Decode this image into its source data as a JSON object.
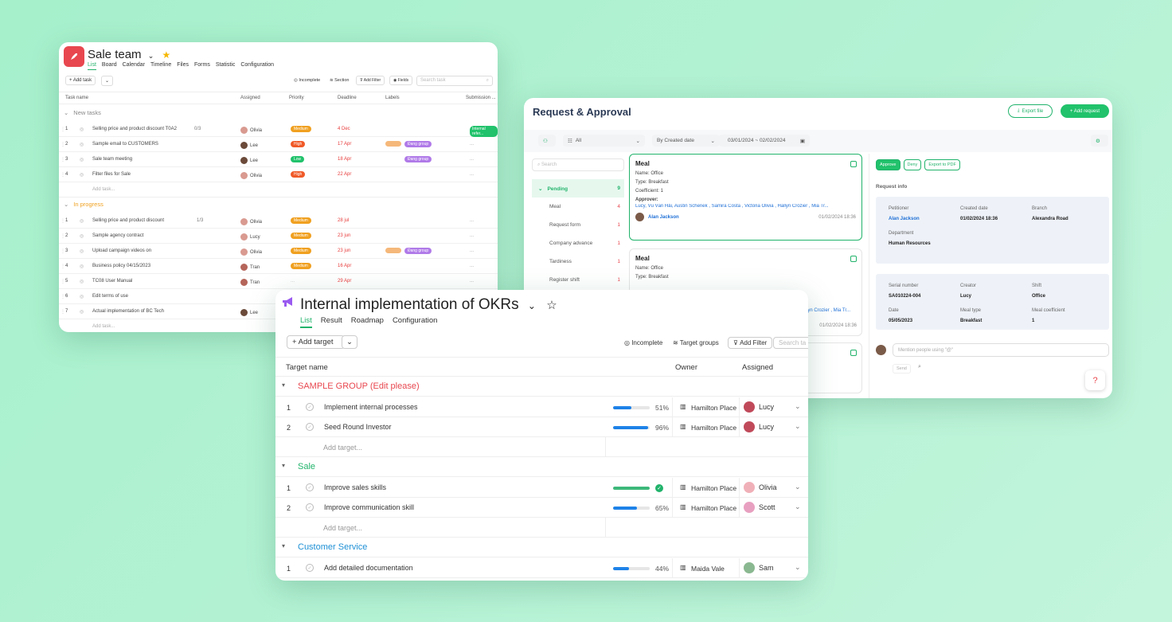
{
  "sale": {
    "title": "Sale team",
    "tabs": [
      "List",
      "Board",
      "Calendar",
      "Timeline",
      "Files",
      "Forms",
      "Statistic",
      "Configuration"
    ],
    "add_task": "+ Add task",
    "toolbar": [
      "Incomplete",
      "Section",
      "Add Filter",
      "Fields"
    ],
    "search_placeholder": "Search task",
    "columns": [
      "Task name",
      "Assigned",
      "Priority",
      "Deadline",
      "Labels",
      "Submission ..."
    ],
    "sections": [
      {
        "name": "New tasks",
        "color": "#888",
        "rows": [
          {
            "n": "1",
            "name": "Selling price and product discount T0A2",
            "sub": "0/3",
            "who": "Olivia",
            "prio": "Medium",
            "pc": "#f0a020",
            "date": "4 Dec",
            "label": "",
            "sub2": "Internal refer..."
          },
          {
            "n": "2",
            "name": "Sample email to CUSTOMERS",
            "sub": "",
            "who": "Lee",
            "prio": "High",
            "pc": "#f05a28",
            "date": "17 Apr",
            "label": "Đang group",
            "sub2": "..."
          },
          {
            "n": "3",
            "name": "Sale team meeting",
            "sub": "",
            "who": "Lee",
            "prio": "Low",
            "pc": "#21c26b",
            "date": "18 Apr",
            "label": "Đang group",
            "sub2": "..."
          },
          {
            "n": "4",
            "name": "Filter files for Sale",
            "sub": "",
            "who": "Olivia",
            "prio": "High",
            "pc": "#f05a28",
            "date": "22 Apr",
            "label": "",
            "sub2": "..."
          }
        ]
      },
      {
        "name": "In progress",
        "color": "#f0a020",
        "rows": [
          {
            "n": "1",
            "name": "Selling price and product discount",
            "sub": "1/3",
            "who": "Olivia",
            "prio": "Medium",
            "pc": "#f0a020",
            "date": "28 jul",
            "label": "",
            "sub2": "..."
          },
          {
            "n": "2",
            "name": "Sample agency contract",
            "sub": "",
            "who": "Lucy",
            "prio": "Medium",
            "pc": "#f0a020",
            "date": "23 jun",
            "label": "",
            "sub2": "..."
          },
          {
            "n": "3",
            "name": "Upload campaign videos on",
            "sub": "",
            "who": "Olivia",
            "prio": "Medium",
            "pc": "#f0a020",
            "date": "23 jun",
            "label": "Đang group",
            "sub2": "..."
          },
          {
            "n": "4",
            "name": "Business policy 04/15/2023",
            "sub": "",
            "who": "Tran",
            "prio": "Medium",
            "pc": "#f0a020",
            "date": "16 Apr",
            "label": "",
            "sub2": "..."
          },
          {
            "n": "5",
            "name": "TC08 User Manual",
            "sub": "",
            "who": "Tran",
            "prio": "",
            "pc": "",
            "date": "29 Apr",
            "label": "",
            "sub2": "..."
          },
          {
            "n": "6",
            "name": "Edit terms of use",
            "sub": "",
            "who": "",
            "prio": "",
            "pc": "",
            "date": "",
            "label": "",
            "sub2": "..."
          },
          {
            "n": "7",
            "name": "Actual implementation of BC Tech",
            "sub": "",
            "who": "Lee",
            "prio": "",
            "pc": "",
            "date": "",
            "label": "",
            "sub2": ""
          }
        ]
      }
    ],
    "add_task_row": "Add task..."
  },
  "request": {
    "title": "Request & Approval",
    "export_file": "Export file",
    "add_request": "+ Add request",
    "filter_all": "All",
    "filter_sort": "By Created date",
    "date_range": "03/01/2024  ~  02/02/2024",
    "search_placeholder": "Search",
    "sidebar": [
      {
        "label": "Pending",
        "count": "9"
      },
      {
        "label": "Meal",
        "count": "4"
      },
      {
        "label": "Request form",
        "count": "1"
      },
      {
        "label": "Company advance",
        "count": "1"
      },
      {
        "label": "Tardiness",
        "count": "1"
      },
      {
        "label": "Register shift",
        "count": "1"
      }
    ],
    "card1": {
      "title": "Meal",
      "name": "Name: Office",
      "type": "Type: Breakfast",
      "coef": "Coefficient: 1",
      "approver_label": "Approver:",
      "approvers": "Lucy, Vũ Văn Hải, Austin Schenek , Samira Costa , Victoria Olivia , Hallyn Crozier , Mia Tr...",
      "user": "Alan Jackson",
      "time": "01/02/2024 18:36"
    },
    "card2": {
      "title": "Meal",
      "name": "Name: Office",
      "type": "Type: Breakfast",
      "approvers": "lyn Crozier , Mia Tr...",
      "time": "01/02/2024 18:36"
    },
    "actions": [
      "Approve",
      "Deny",
      "Export to PDF"
    ],
    "info_title": "Request info",
    "info": {
      "petitioner_k": "Petitioner",
      "petitioner": "Alan Jackson",
      "created_k": "Created date",
      "created": "01/02/2024 18:36",
      "branch_k": "Branch",
      "branch": "Alexandra Road",
      "dept_k": "Department",
      "dept": "Human Resources",
      "serial_k": "Serial number",
      "serial": "SA010224-004",
      "creator_k": "Creator",
      "creator": "Lucy",
      "shift_k": "Shift",
      "shift": "Office",
      "date_k": "Date",
      "date": "05/05/2023",
      "mealtype_k": "Meal type",
      "mealtype": "Breakfast",
      "mealcoef_k": "Meal coefficient",
      "mealcoef": "1"
    },
    "comment_placeholder": "Mention people using \"@\"",
    "send": "Send",
    "help": "?"
  },
  "okr": {
    "title": "Internal implementation of OKRs",
    "tabs": [
      "List",
      "Result",
      "Roadmap",
      "Configuration"
    ],
    "add_target": "+ Add target",
    "toolbar": [
      "Incomplete",
      "Target groups",
      "Add Filter"
    ],
    "search_placeholder": "Search ta",
    "columns": [
      "Target name",
      "Owner",
      "Assigned"
    ],
    "add_target_row": "Add target...",
    "groups": [
      {
        "name": "SAMPLE GROUP (Edit please)",
        "color": "#e8474f",
        "rows": [
          {
            "n": "1",
            "name": "Implement internal processes",
            "pct": "51%",
            "p": 0.51,
            "done": false,
            "owner": "Hamilton Place",
            "who": "Lucy"
          },
          {
            "n": "2",
            "name": "Seed Round Investor",
            "pct": "96%",
            "p": 0.96,
            "done": false,
            "owner": "Hamilton Place",
            "who": "Lucy"
          }
        ]
      },
      {
        "name": "Sale",
        "color": "#21b36b",
        "rows": [
          {
            "n": "1",
            "name": "Improve sales skills",
            "pct": "",
            "p": 1,
            "done": true,
            "owner": "Hamilton Place",
            "who": "Olivia"
          },
          {
            "n": "2",
            "name": "Improve communication skill",
            "pct": "65%",
            "p": 0.65,
            "done": false,
            "owner": "Hamilton Place",
            "who": "Scott"
          }
        ]
      },
      {
        "name": "Customer Service",
        "color": "#1e90d6",
        "rows": [
          {
            "n": "1",
            "name": "Add detailed documentation",
            "pct": "44%",
            "p": 0.44,
            "done": false,
            "owner": "Maida Vale",
            "who": "Sam"
          }
        ]
      }
    ]
  }
}
